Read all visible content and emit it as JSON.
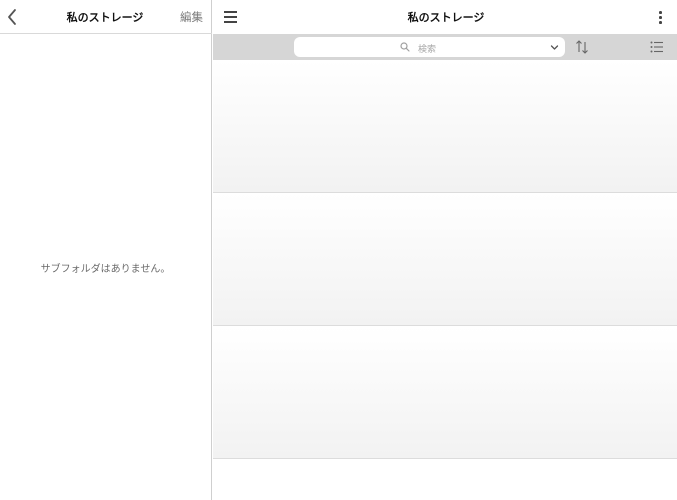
{
  "left_panel": {
    "title": "私のストレージ",
    "edit_label": "編集",
    "empty_message": "サブフォルダはありません。"
  },
  "right_panel": {
    "title": "私のストレージ",
    "search": {
      "placeholder": "検索"
    },
    "rows": [
      {
        "label": ""
      },
      {
        "label": ""
      },
      {
        "label": ""
      }
    ]
  },
  "icons": {
    "back": "chevron-left-icon",
    "menu": "hamburger-menu-icon",
    "more": "more-vertical-icon",
    "search": "search-icon",
    "dropdown": "chevron-down-icon",
    "sort": "sort-arrows-icon",
    "view": "list-view-icon"
  },
  "colors": {
    "search_bar_bg": "#d6d6d6",
    "edit_text": "#7b7b7b",
    "empty_text": "#6a6a6a"
  }
}
